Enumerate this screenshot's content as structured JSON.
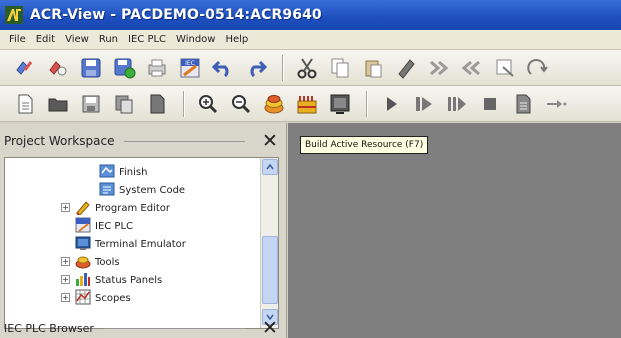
{
  "window": {
    "title": "ACR-View - PACDEMO-0514:ACR9640"
  },
  "menu": {
    "items": [
      "File",
      "Edit",
      "View",
      "Run",
      "IEC PLC",
      "Window",
      "Help"
    ]
  },
  "toolbar1": {
    "icons": [
      "connect-icon",
      "disconnect-icon",
      "save-icon",
      "save-all-icon",
      "print-icon",
      "iec-settings-icon",
      "undo-icon",
      "redo-icon",
      "cut-icon",
      "copy-icon",
      "paste-icon",
      "find-icon",
      "indent-icon",
      "outdent-icon",
      "comment-icon",
      "uncomment-icon"
    ]
  },
  "toolbar2": {
    "icons": [
      "new-document-icon",
      "open-folder-icon",
      "save-file-icon",
      "copy-file-icon",
      "document-icon",
      "zoom-in-icon",
      "zoom-out-icon",
      "build-active-resource-icon",
      "rebuild-icon",
      "monitor-icon",
      "run-icon",
      "step-icon",
      "step-over-icon",
      "stop-icon",
      "page-icon",
      "arrow-icon"
    ]
  },
  "tooltip": {
    "text": "Build Active Resource (F7)"
  },
  "workspace_panel": {
    "title": "Project Workspace",
    "close": "✕"
  },
  "tree": {
    "items": [
      {
        "label": "Finish",
        "icon": "finish-icon"
      },
      {
        "label": "System Code",
        "icon": "system-code-icon"
      },
      {
        "label": "Program Editor",
        "icon": "program-editor-icon"
      },
      {
        "label": "IEC PLC",
        "icon": "iec-plc-icon"
      },
      {
        "label": "Terminal Emulator",
        "icon": "terminal-emulator-icon"
      },
      {
        "label": "Tools",
        "icon": "tools-icon"
      },
      {
        "label": "Status Panels",
        "icon": "status-panels-icon"
      },
      {
        "label": "Scopes",
        "icon": "scopes-icon"
      }
    ]
  },
  "browser_panel": {
    "title": "IEC PLC Browser",
    "close": "✕"
  }
}
